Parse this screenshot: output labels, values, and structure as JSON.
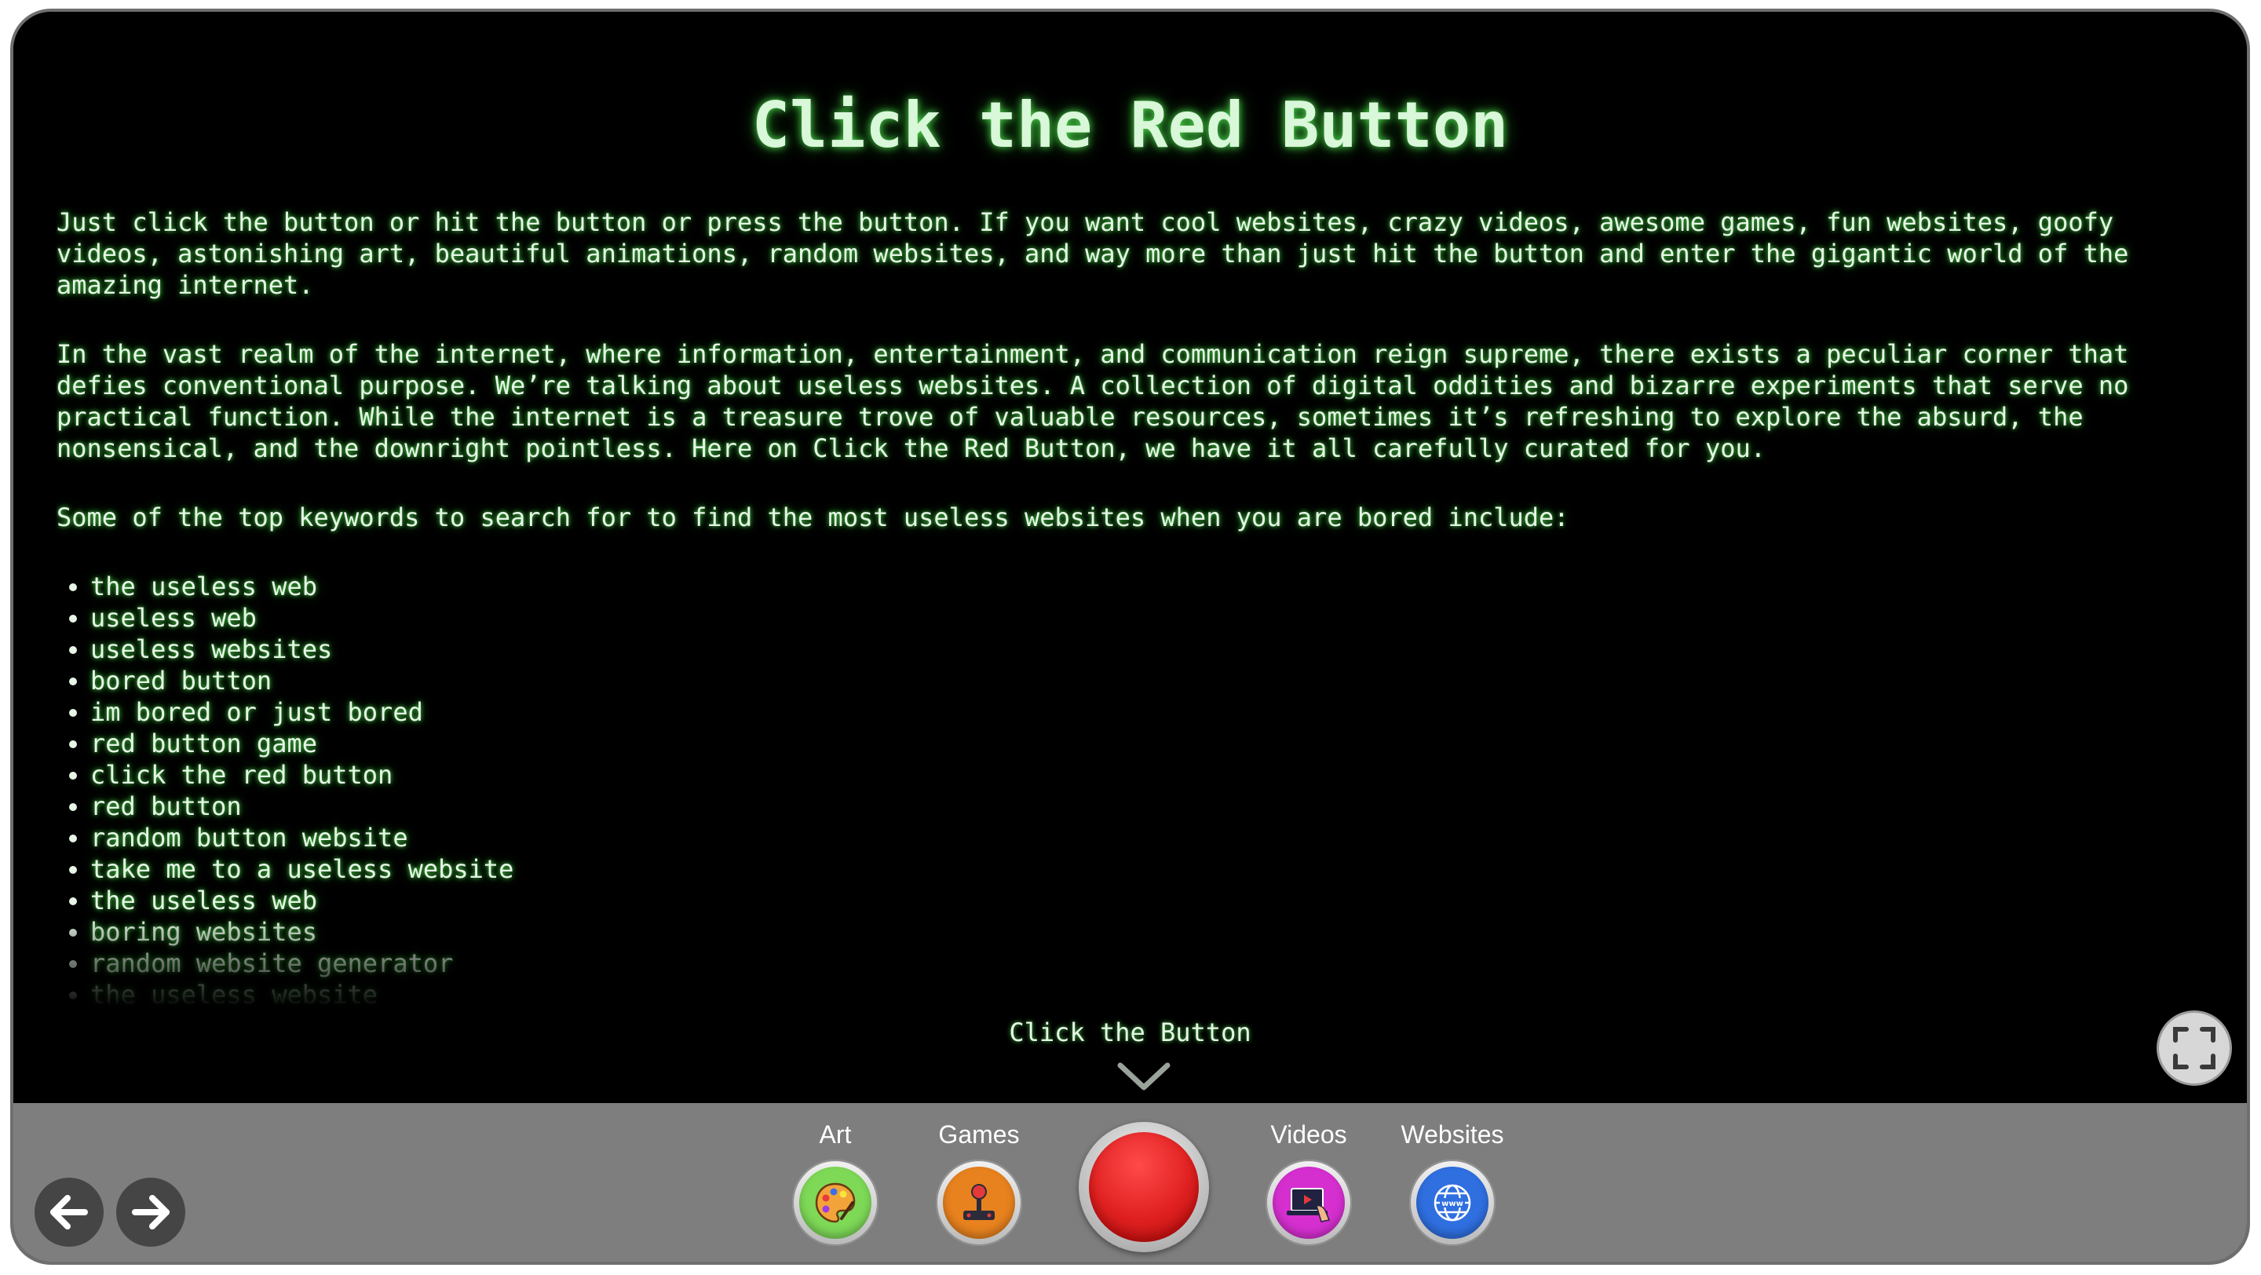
{
  "page": {
    "title": "Click the Red Button",
    "paragraphs": [
      "Just click the button or hit the button or press the button. If you want cool websites, crazy videos, awesome games, fun websites, goofy videos, astonishing art, beautiful animations, random websites, and way more than just hit the button and enter the gigantic world of the amazing internet.",
      "In the vast realm of the internet, where information, entertainment, and communication reign supreme, there exists a peculiar corner that defies conventional purpose. We’re talking about useless websites. A collection of digital oddities and bizarre experiments that serve no practical function. While the internet is a treasure trove of valuable resources, sometimes it’s refreshing to explore the absurd, the nonsensical, and the downright pointless. Here on Click the Red Button, we have it all carefully curated for you.",
      "Some of the top keywords to search for to find the most useless websites when you are bored include:"
    ],
    "keywords": [
      "the useless web",
      "useless web",
      "useless websites",
      "bored button",
      "im bored or just bored",
      "red button game",
      "click the red button",
      "red button",
      "random button website",
      "take me to a useless website",
      "the useless web",
      "boring websites",
      "random website generator",
      "the useless website"
    ],
    "cta_label": "Click the Button"
  },
  "toolbar": {
    "categories": [
      {
        "label": "Art",
        "icon": "art-palette-icon",
        "color": "#7ed957"
      },
      {
        "label": "Games",
        "icon": "joystick-icon",
        "color": "#e8821e"
      },
      {
        "label": "Videos",
        "icon": "video-laptop-icon",
        "color": "#d62fd0"
      },
      {
        "label": "Websites",
        "icon": "globe-www-icon",
        "color": "#2f6fe0"
      }
    ],
    "red_button_color": "#e02020",
    "back_icon": "arrow-left-icon",
    "forward_icon": "arrow-right-icon",
    "fullscreen_icon": "fullscreen-icon"
  },
  "colors": {
    "screen_background": "#000000",
    "text_glow": "#5aff5a",
    "toolbar_background": "#7e7e7e"
  }
}
